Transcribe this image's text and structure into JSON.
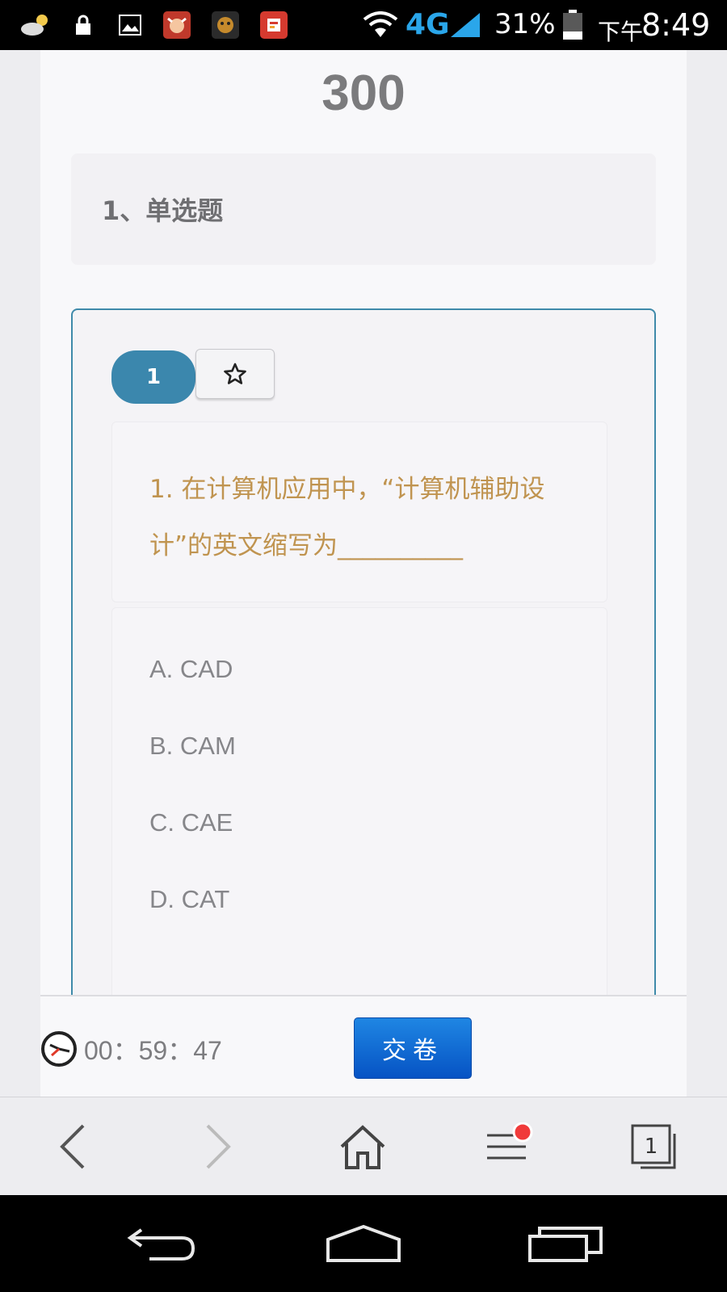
{
  "status_bar": {
    "battery_percent": "31%",
    "network": "4G",
    "ampm": "下午",
    "time": "8:49",
    "icons": [
      "weather-icon",
      "lock-icon",
      "gallery-icon",
      "app-icon-red-bull",
      "app-icon-tiger",
      "app-icon-news",
      "wifi-icon",
      "signal-icon",
      "battery-icon"
    ]
  },
  "page": {
    "title": "300",
    "section_label": "1、单选题"
  },
  "question": {
    "number_label": "1",
    "favorite_icon": "star-icon",
    "stem": "1. 在计算机应用中，“计算机辅助设计”的英文缩写为__________",
    "options": [
      {
        "label": "A. CAD"
      },
      {
        "label": "B. CAM"
      },
      {
        "label": "C. CAE"
      },
      {
        "label": "D. CAT"
      }
    ]
  },
  "exam_bar": {
    "timer": "00：59：47",
    "submit_label": "交卷"
  },
  "browser_bar": {
    "tab_count": "1",
    "icons": [
      "back-icon",
      "forward-icon",
      "home-icon",
      "menu-icon",
      "tabs-icon"
    ]
  },
  "colors": {
    "accent": "#3b87ad",
    "stem_text": "#c09450",
    "submit": "#0a62d0",
    "notification_dot": "#f03a3a"
  }
}
